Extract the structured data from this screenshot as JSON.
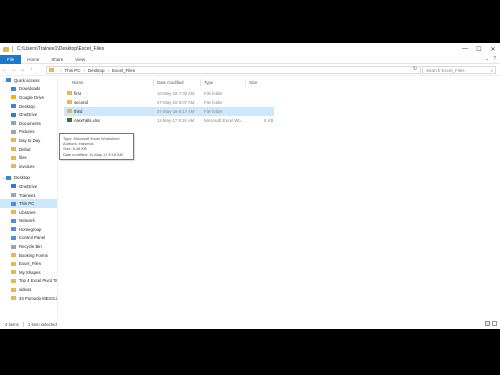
{
  "window": {
    "title": "C:\\Users\\Trainee1\\Desktop\\Excel_Files",
    "controls": [
      "—",
      "☐",
      "✕"
    ]
  },
  "ribbon": {
    "tabs": [
      "File",
      "Home",
      "Share",
      "View"
    ],
    "expand": "⌄",
    "help": "?"
  },
  "nav": {
    "back": "←",
    "forward": "→",
    "up_dropdown": "⌄",
    "up": "↑",
    "breadcrumbs": [
      "This PC",
      "Desktop",
      "Excel_Files"
    ],
    "refresh": "↻",
    "search_placeholder": "Search Excel_Files"
  },
  "sidebar": {
    "items": [
      {
        "label": "Quick access",
        "level": 0,
        "color": "#3a86d4"
      },
      {
        "label": "Downloads",
        "level": 1,
        "color": "#3a86d4"
      },
      {
        "label": "Google Drive",
        "level": 1,
        "color": "#f4b400"
      },
      {
        "label": "Desktop",
        "level": 1,
        "color": "#3a86d4"
      },
      {
        "label": "OneDrive",
        "level": 1,
        "color": "#2a7bd4"
      },
      {
        "label": "Documents",
        "level": 1,
        "color": "#9aa3b0"
      },
      {
        "label": "Pictures",
        "level": 1,
        "color": "#9aa3b0"
      },
      {
        "label": "Day to Day",
        "level": 1,
        "color": "#e8b64b"
      },
      {
        "label": "Debut",
        "level": 1,
        "color": "#e8b64b"
      },
      {
        "label": "files",
        "level": 1,
        "color": "#e8b64b"
      },
      {
        "label": "invoices",
        "level": 1,
        "color": "#e8b64b"
      },
      {
        "label": "Desktop",
        "level": 0,
        "color": "#3a86d4"
      },
      {
        "label": "OneDrive",
        "level": 1,
        "color": "#2a7bd4"
      },
      {
        "label": "Trainee1",
        "level": 1,
        "color": "#9aa3b0"
      },
      {
        "label": "This PC",
        "level": 1,
        "color": "#4a8fd8",
        "selected": true
      },
      {
        "label": "Libraries",
        "level": 1,
        "color": "#e8b64b"
      },
      {
        "label": "Network",
        "level": 1,
        "color": "#4a8fd8"
      },
      {
        "label": "Homegroup",
        "level": 1,
        "color": "#4a8fd8"
      },
      {
        "label": "Control Panel",
        "level": 1,
        "color": "#4a8fd8"
      },
      {
        "label": "Recycle Bin",
        "level": 1,
        "color": "#9aa3b0"
      },
      {
        "label": "Booking Forms",
        "level": 1,
        "color": "#e8b64b"
      },
      {
        "label": "Excel_Files",
        "level": 1,
        "color": "#e8b64b"
      },
      {
        "label": "My Shapes",
        "level": 1,
        "color": "#e8b64b"
      },
      {
        "label": "Top 4 Excel Pivot Ta",
        "level": 1,
        "color": "#e8b64b"
      },
      {
        "label": "videos",
        "level": 1,
        "color": "#e8b64b"
      },
      {
        "label": "33 Pomodo MEGS.ip",
        "level": 1,
        "color": "#e8b64b"
      }
    ]
  },
  "columns": {
    "name": "Name",
    "date": "Date modified",
    "type": "Type",
    "size": "Size"
  },
  "files": [
    {
      "name": "first",
      "date": "16-May-18 7:00 AM",
      "type": "File folder",
      "size": "",
      "color": "#e8b64b"
    },
    {
      "name": "second",
      "date": "27-May-18 8:07 AM",
      "type": "File folder",
      "size": "",
      "color": "#e8b64b"
    },
    {
      "name": "third",
      "date": "27-May-18 8:17 AM",
      "type": "File folder",
      "size": "",
      "color": "#e8b64b",
      "selected": true
    },
    {
      "name": "AlexFalls.xlsx",
      "date": "11-May-17 8:16 AM",
      "type": "Microsoft Excel Wo...",
      "size": "9 KB",
      "color": "#1d7a45"
    }
  ],
  "tooltip": {
    "lines": [
      "Type: Microsoft Excel Worksheet",
      "Authors: erasmus",
      "Size: 8.45 KB",
      "Date modified: 11-May-17 8:16 AM"
    ]
  },
  "status": {
    "count": "4 items",
    "selection": "1 item selected"
  }
}
